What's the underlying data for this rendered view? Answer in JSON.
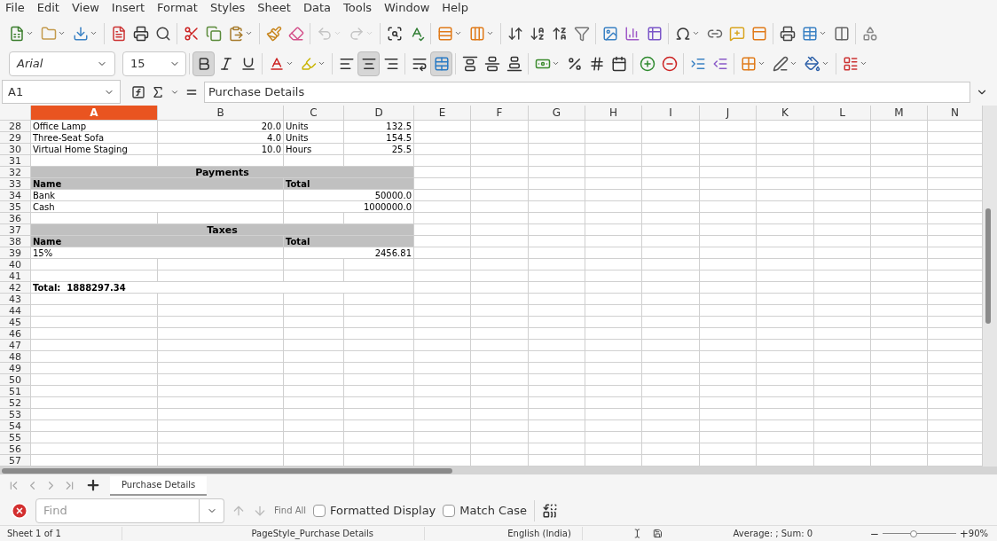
{
  "menu": [
    "File",
    "Edit",
    "View",
    "Insert",
    "Format",
    "Styles",
    "Sheet",
    "Data",
    "Tools",
    "Window",
    "Help"
  ],
  "standard_toolbar": [
    [
      {
        "kind": "new",
        "dropdown": true,
        "disabled": false
      },
      {
        "kind": "open",
        "dropdown": true,
        "disabled": false
      },
      {
        "kind": "save",
        "dropdown": true,
        "disabled": false
      }
    ],
    [
      {
        "kind": "pdf",
        "dropdown": false,
        "disabled": false
      },
      {
        "kind": "print",
        "dropdown": false,
        "disabled": false
      },
      {
        "kind": "preview",
        "dropdown": false,
        "disabled": false
      }
    ],
    [
      {
        "kind": "cut",
        "dropdown": false,
        "disabled": false
      },
      {
        "kind": "copy",
        "dropdown": false,
        "disabled": false
      },
      {
        "kind": "paste",
        "dropdown": true,
        "disabled": false
      }
    ],
    [
      {
        "kind": "clone",
        "dropdown": false,
        "disabled": false
      },
      {
        "kind": "clear",
        "dropdown": false,
        "disabled": false
      }
    ],
    [
      {
        "kind": "undo",
        "dropdown": true,
        "disabled": true
      },
      {
        "kind": "redo",
        "dropdown": true,
        "disabled": true
      }
    ],
    [
      {
        "kind": "find",
        "dropdown": false,
        "disabled": false
      },
      {
        "kind": "spelling",
        "dropdown": false,
        "disabled": false
      }
    ],
    [
      {
        "kind": "rows",
        "dropdown": true,
        "disabled": false
      },
      {
        "kind": "columns",
        "dropdown": true,
        "disabled": false
      }
    ],
    [
      {
        "kind": "sort",
        "dropdown": false,
        "disabled": false
      },
      {
        "kind": "sortasc",
        "dropdown": false,
        "disabled": false
      },
      {
        "kind": "sortdesc",
        "dropdown": false,
        "disabled": false
      },
      {
        "kind": "filter",
        "dropdown": false,
        "disabled": false
      }
    ],
    [
      {
        "kind": "image",
        "dropdown": false,
        "disabled": false
      },
      {
        "kind": "chart",
        "dropdown": false,
        "disabled": false
      },
      {
        "kind": "pivot",
        "dropdown": false,
        "disabled": false
      }
    ],
    [
      {
        "kind": "special",
        "dropdown": true,
        "disabled": false
      },
      {
        "kind": "link",
        "dropdown": false,
        "disabled": false
      },
      {
        "kind": "comment",
        "dropdown": false,
        "disabled": false
      },
      {
        "kind": "header",
        "dropdown": false,
        "disabled": false
      }
    ],
    [
      {
        "kind": "printrange",
        "dropdown": false,
        "disabled": false
      },
      {
        "kind": "freeze",
        "dropdown": true,
        "disabled": false
      },
      {
        "kind": "split",
        "dropdown": false,
        "disabled": false
      }
    ],
    [
      {
        "kind": "shapes",
        "dropdown": false,
        "disabled": false
      }
    ]
  ],
  "font_name": "Arial",
  "font_size": "15",
  "format_toolbar": [
    [
      {
        "kind": "bold",
        "dropdown": false,
        "on": true
      },
      {
        "kind": "italic",
        "dropdown": false,
        "on": false
      },
      {
        "kind": "underline",
        "dropdown": false,
        "on": false
      }
    ],
    [
      {
        "kind": "fontcolor",
        "dropdown": true,
        "on": false
      },
      {
        "kind": "highlight",
        "dropdown": true,
        "on": false
      }
    ],
    [
      {
        "kind": "left",
        "dropdown": false,
        "on": false
      },
      {
        "kind": "center",
        "dropdown": false,
        "on": true
      },
      {
        "kind": "right",
        "dropdown": false,
        "on": false
      }
    ],
    [
      {
        "kind": "wrap",
        "dropdown": false,
        "on": false
      },
      {
        "kind": "merge",
        "dropdown": false,
        "on": true
      }
    ],
    [
      {
        "kind": "top",
        "dropdown": false,
        "on": false
      },
      {
        "kind": "middle",
        "dropdown": false,
        "on": false
      },
      {
        "kind": "bottom",
        "dropdown": false,
        "on": false
      }
    ],
    [
      {
        "kind": "currency",
        "dropdown": true,
        "on": false
      },
      {
        "kind": "percent",
        "dropdown": false,
        "on": false
      },
      {
        "kind": "number",
        "dropdown": false,
        "on": false
      },
      {
        "kind": "date",
        "dropdown": false,
        "on": false
      }
    ],
    [
      {
        "kind": "adddecimal",
        "dropdown": false,
        "on": false
      },
      {
        "kind": "deldecimal",
        "dropdown": false,
        "on": false
      }
    ],
    [
      {
        "kind": "indent",
        "dropdown": false,
        "on": false
      },
      {
        "kind": "outdent",
        "dropdown": false,
        "on": false
      }
    ],
    [
      {
        "kind": "borders",
        "dropdown": true,
        "on": false
      },
      {
        "kind": "borderstyle",
        "dropdown": true,
        "on": false
      },
      {
        "kind": "bordercolor",
        "dropdown": true,
        "on": false
      }
    ],
    [
      {
        "kind": "conditional",
        "dropdown": true,
        "on": false
      }
    ]
  ],
  "name_box": "A1",
  "formula": "Purchase Details",
  "columns": [
    {
      "label": "A",
      "selected": true
    },
    {
      "label": "B",
      "selected": false
    },
    {
      "label": "C",
      "selected": false
    },
    {
      "label": "D",
      "selected": false
    },
    {
      "label": "E",
      "selected": false
    },
    {
      "label": "F",
      "selected": false
    },
    {
      "label": "G",
      "selected": false
    },
    {
      "label": "H",
      "selected": false
    },
    {
      "label": "I",
      "selected": false
    },
    {
      "label": "J",
      "selected": false
    },
    {
      "label": "K",
      "selected": false
    },
    {
      "label": "L",
      "selected": false
    },
    {
      "label": "M",
      "selected": false
    },
    {
      "label": "N",
      "selected": false
    }
  ],
  "rows": [
    {
      "number": "28",
      "kind": "item",
      "cells": [
        "Office Lamp",
        "20.0",
        "Units",
        "132.5"
      ]
    },
    {
      "number": "29",
      "kind": "item",
      "cells": [
        "Three-Seat Sofa",
        "4.0",
        "Units",
        "154.5"
      ]
    },
    {
      "number": "30",
      "kind": "item",
      "cells": [
        "Virtual Home Staging",
        "10.0",
        "Hours",
        "25.5"
      ]
    },
    {
      "number": "31",
      "kind": "blank"
    },
    {
      "number": "32",
      "kind": "section",
      "title": "Payments"
    },
    {
      "number": "33",
      "kind": "header",
      "cells": [
        "Name",
        "Total"
      ]
    },
    {
      "number": "34",
      "kind": "entry",
      "cells": [
        "Bank",
        "50000.0"
      ]
    },
    {
      "number": "35",
      "kind": "entry",
      "cells": [
        "Cash",
        "1000000.0"
      ]
    },
    {
      "number": "36",
      "kind": "blank"
    },
    {
      "number": "37",
      "kind": "section",
      "title": "Taxes"
    },
    {
      "number": "38",
      "kind": "header",
      "cells": [
        "Name",
        "Total"
      ]
    },
    {
      "number": "39",
      "kind": "entry",
      "cells": [
        "15%",
        "2456.81"
      ]
    },
    {
      "number": "40",
      "kind": "blank"
    },
    {
      "number": "41",
      "kind": "blank"
    },
    {
      "number": "42",
      "kind": "total",
      "title": "Total:  1888297.34"
    },
    {
      "number": "43",
      "kind": "blank"
    },
    {
      "number": "44",
      "kind": "blank"
    },
    {
      "number": "45",
      "kind": "blank"
    },
    {
      "number": "46",
      "kind": "blank"
    },
    {
      "number": "47",
      "kind": "blank"
    },
    {
      "number": "48",
      "kind": "blank"
    },
    {
      "number": "49",
      "kind": "blank"
    },
    {
      "number": "50",
      "kind": "blank"
    },
    {
      "number": "51",
      "kind": "blank"
    },
    {
      "number": "52",
      "kind": "blank"
    },
    {
      "number": "53",
      "kind": "blank"
    },
    {
      "number": "54",
      "kind": "blank"
    },
    {
      "number": "55",
      "kind": "blank"
    },
    {
      "number": "56",
      "kind": "blank"
    },
    {
      "number": "57",
      "kind": "blank"
    }
  ],
  "sheet_tabs": [
    {
      "label": "Purchase Details",
      "selected": true
    }
  ],
  "find_bar": {
    "placeholder": "Find",
    "find_all": "Find All",
    "options": [
      {
        "label": "Formatted Display",
        "checked": false
      },
      {
        "label": "Match Case",
        "checked": false
      }
    ]
  },
  "status_bar": {
    "sheet": "Sheet 1 of 1",
    "page_style": "PageStyle_Purchase Details",
    "language": "English (India)",
    "summary": "Average: ; Sum: 0",
    "zoom_out": "−",
    "zoom_slider": {
      "level": 0.42
    },
    "zoom_in": "+",
    "zoom": "90%"
  }
}
